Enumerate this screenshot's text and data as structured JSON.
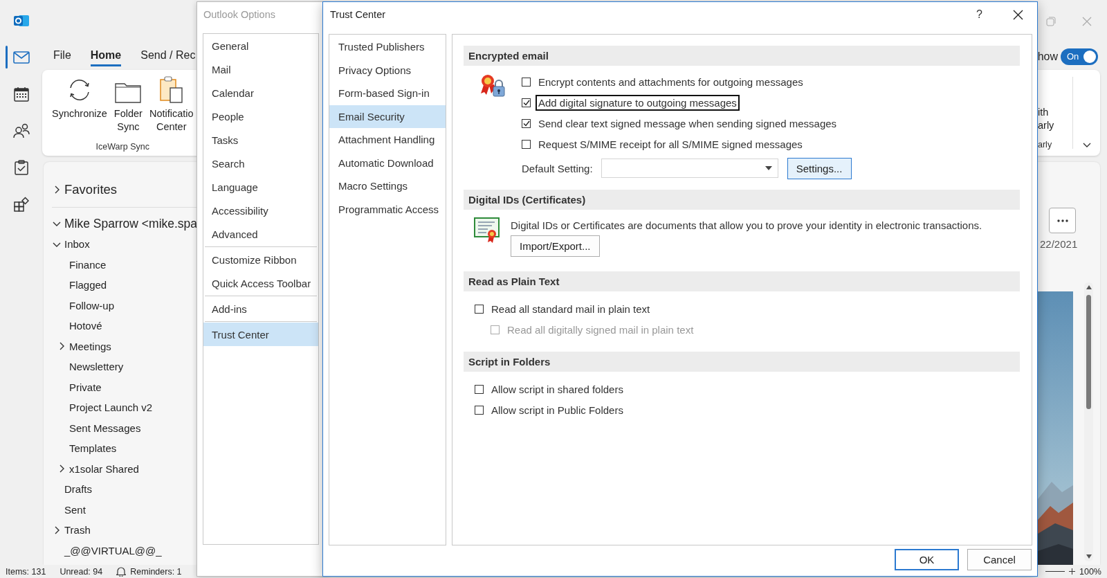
{
  "rail": [
    {
      "kind": "mail",
      "selected": true
    },
    {
      "kind": "calendar",
      "selected": false
    },
    {
      "kind": "people",
      "selected": false
    },
    {
      "kind": "tasks",
      "selected": false
    },
    {
      "kind": "apps",
      "selected": false
    }
  ],
  "ribbon_tabs": [
    {
      "label": "File",
      "selected": false
    },
    {
      "label": "Home",
      "selected": true
    },
    {
      "label": "Send / Rec",
      "selected": false
    }
  ],
  "view_toggle": {
    "label": "how",
    "on": true,
    "state_text": "On"
  },
  "ribbon": {
    "buttons": [
      {
        "kind": "sync",
        "lines": [
          "Synchronize"
        ]
      },
      {
        "kind": "folder",
        "lines": [
          "Folder",
          "Sync"
        ]
      },
      {
        "kind": "clipboard",
        "lines": [
          "Notificatio",
          "Center"
        ]
      }
    ],
    "group_label": "IceWarp Sync",
    "cut_button_lines": [
      "ith",
      "arly"
    ],
    "cut_group_label": "arly"
  },
  "folder_pane": {
    "favorites": {
      "label": "Favorites",
      "expanded": false
    },
    "folders": [
      {
        "label": "Mike Sparrow <mike.spa",
        "expanded": true,
        "children": [
          {
            "label": "Inbox",
            "expanded": true,
            "children": [
              {
                "label": "Finance"
              },
              {
                "label": "Flagged"
              },
              {
                "label": "Follow-up"
              },
              {
                "label": "Hotové"
              },
              {
                "label": "Meetings",
                "expanded": false
              },
              {
                "label": "Newslettery"
              },
              {
                "label": "Private"
              },
              {
                "label": "Project Launch v2"
              },
              {
                "label": "Sent Messages"
              },
              {
                "label": "Templates"
              },
              {
                "label": "x1solar Shared",
                "expanded": false
              }
            ]
          },
          {
            "label": "Drafts"
          },
          {
            "label": "Sent"
          },
          {
            "label": "Trash",
            "expanded": false
          },
          {
            "label": "_@@VIRTUAL@@_"
          }
        ]
      }
    ]
  },
  "reading_pane": {
    "date": "22/2021"
  },
  "status_bar": {
    "items": "Items: 131",
    "unread": "Unread: 94",
    "reminders": "Reminders: 1",
    "zoom": "100%"
  },
  "options_dialog": {
    "title": "Outlook Options",
    "groups": [
      {
        "items": [
          {
            "label": "General",
            "selected": false
          },
          {
            "label": "Mail",
            "selected": false
          },
          {
            "label": "Calendar",
            "selected": false
          },
          {
            "label": "People",
            "selected": false
          },
          {
            "label": "Tasks",
            "selected": false
          },
          {
            "label": "Search",
            "selected": false
          },
          {
            "label": "Language",
            "selected": false
          },
          {
            "label": "Accessibility",
            "selected": false
          },
          {
            "label": "Advanced",
            "selected": false
          }
        ]
      },
      {
        "items": [
          {
            "label": "Customize Ribbon",
            "selected": false
          },
          {
            "label": "Quick Access Toolbar",
            "selected": false
          }
        ]
      },
      {
        "items": [
          {
            "label": "Add-ins",
            "selected": false
          }
        ]
      },
      {
        "items": [
          {
            "label": "Trust Center",
            "selected": true
          }
        ]
      }
    ]
  },
  "trust_center": {
    "title": "Trust Center",
    "help": "?",
    "nav": [
      {
        "label": "Trusted Publishers",
        "selected": false
      },
      {
        "label": "Privacy Options",
        "selected": false
      },
      {
        "label": "Form-based Sign-in",
        "selected": false
      },
      {
        "label": "Email Security",
        "selected": true
      },
      {
        "label": "Attachment Handling",
        "selected": false
      },
      {
        "label": "Automatic Download",
        "selected": false
      },
      {
        "label": "Macro Settings",
        "selected": false
      },
      {
        "label": "Programmatic Access",
        "selected": false
      }
    ],
    "sections": [
      {
        "kind": "encrypted_email",
        "title": "Encrypted email",
        "options": [
          {
            "label": "Encrypt contents and attachments for outgoing messages",
            "checked": false,
            "disabled": false,
            "focused": false
          },
          {
            "label": "Add digital signature to outgoing messages",
            "checked": true,
            "disabled": false,
            "focused": true
          },
          {
            "label": "Send clear text signed message when sending signed messages",
            "checked": true,
            "disabled": false,
            "focused": false
          },
          {
            "label": "Request S/MIME receipt for all S/MIME signed messages",
            "checked": false,
            "disabled": false,
            "focused": false
          }
        ],
        "default_setting": {
          "label": "Default Setting:"
        },
        "button": "Settings..."
      },
      {
        "kind": "digital_ids",
        "title": "Digital IDs (Certificates)",
        "description": "Digital IDs or Certificates are documents that allow you to prove your identity in electronic transactions.",
        "button": "Import/Export..."
      },
      {
        "kind": "plain_text",
        "title": "Read as Plain Text",
        "options": [
          {
            "label": "Read all standard mail in plain text",
            "checked": false,
            "disabled": false,
            "focused": false,
            "children": [
              {
                "label": "Read all digitally signed mail in plain text",
                "checked": false,
                "disabled": true,
                "focused": false
              }
            ]
          }
        ]
      },
      {
        "kind": "script_folders",
        "title": "Script in Folders",
        "options": [
          {
            "label": "Allow script in shared folders",
            "checked": false,
            "disabled": false,
            "focused": false
          },
          {
            "label": "Allow script in Public Folders",
            "checked": false,
            "disabled": false,
            "focused": false
          }
        ]
      }
    ],
    "buttons": [
      {
        "label": "OK",
        "default": true
      },
      {
        "label": "Cancel",
        "default": false
      }
    ]
  }
}
